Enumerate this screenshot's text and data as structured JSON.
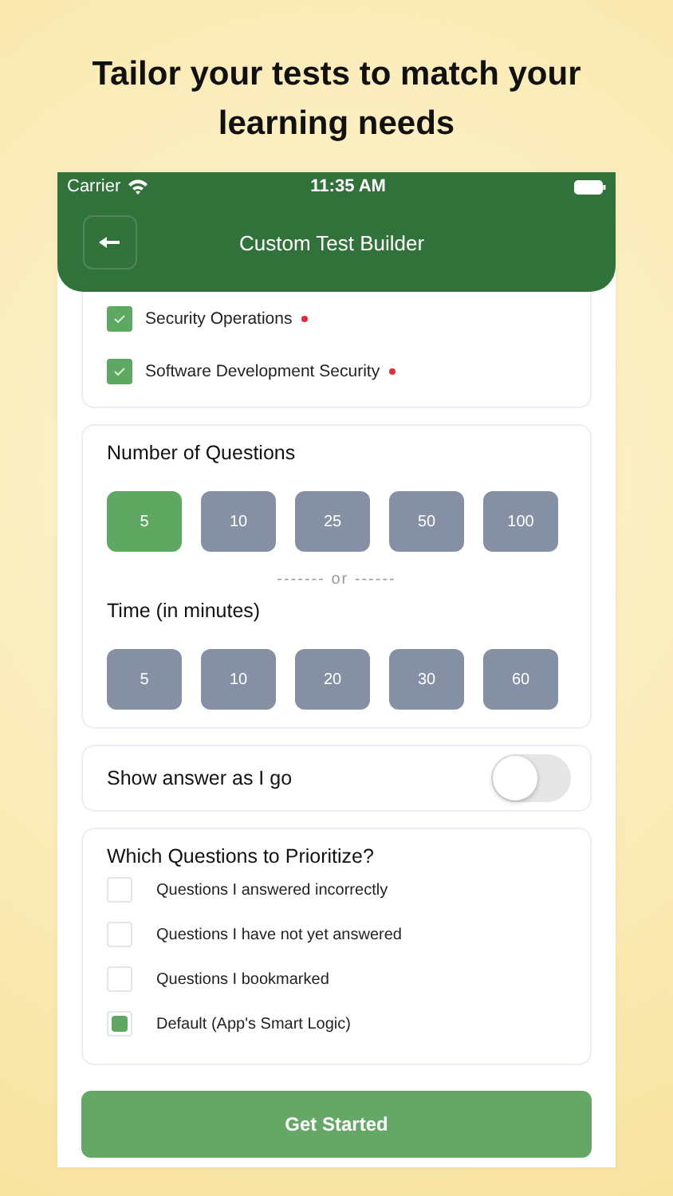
{
  "headline": "Tailor your tests to match your learning needs",
  "status_bar": {
    "carrier": "Carrier",
    "time": "11:35 AM"
  },
  "header": {
    "title": "Custom Test Builder"
  },
  "domains": [
    {
      "label": "Security Operations",
      "checked": true,
      "flagged": true
    },
    {
      "label": "Software Development Security",
      "checked": true,
      "flagged": true
    }
  ],
  "number_of_questions": {
    "title": "Number of Questions",
    "options": [
      {
        "label": "5",
        "selected": true
      },
      {
        "label": "10",
        "selected": false
      },
      {
        "label": "25",
        "selected": false
      },
      {
        "label": "50",
        "selected": false
      },
      {
        "label": "100",
        "selected": false
      }
    ]
  },
  "separator": "------- or ------",
  "time": {
    "title": "Time (in minutes)",
    "options": [
      {
        "label": "5",
        "selected": false
      },
      {
        "label": "10",
        "selected": false
      },
      {
        "label": "20",
        "selected": false
      },
      {
        "label": "30",
        "selected": false
      },
      {
        "label": "60",
        "selected": false
      }
    ]
  },
  "show_answer": {
    "label": "Show answer as I go",
    "on": false
  },
  "prioritize": {
    "title": "Which Questions to Prioritize?",
    "options": [
      {
        "label": "Questions I answered incorrectly",
        "selected": false
      },
      {
        "label": "Questions I have not yet answered",
        "selected": false
      },
      {
        "label": "Questions I bookmarked",
        "selected": false
      },
      {
        "label": "Default (App's Smart Logic)",
        "selected": true
      }
    ]
  },
  "button": "Get Started"
}
